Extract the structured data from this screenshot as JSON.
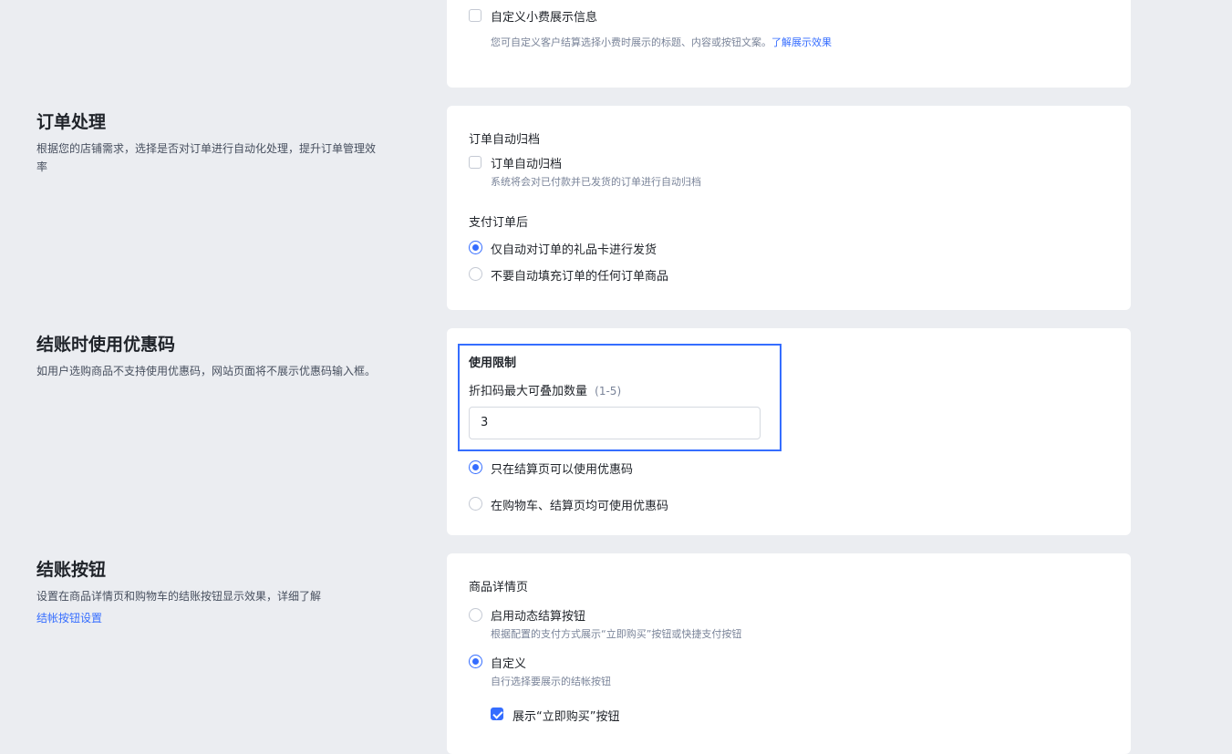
{
  "tip_section": {
    "checkbox_label": "自定义小费展示信息",
    "description": "您可自定义客户结算选择小费时展示的标题、内容或按钮文案。",
    "link": "了解展示效果"
  },
  "order_processing": {
    "title": "订单处理",
    "description": "根据您的店铺需求，选择是否对订单进行自动化处理，提升订单管理效率",
    "auto_archive_heading": "订单自动归档",
    "auto_archive_checkbox": "订单自动归档",
    "auto_archive_sub": "系统将会对已付款并已发货的订单进行自动归档",
    "after_payment_heading": "支付订单后",
    "options": [
      {
        "label": "仅自动对订单的礼品卡进行发货",
        "checked": true
      },
      {
        "label": "不要自动填充订单的任何订单商品",
        "checked": false
      }
    ]
  },
  "discount_code": {
    "title": "结账时使用优惠码",
    "description": "如用户选购商品不支持使用优惠码，网站页面将不展示优惠码输入框。",
    "usage_limit_heading": "使用限制",
    "max_stack_label": "折扣码最大可叠加数量",
    "max_stack_range": "(1-5)",
    "max_stack_value": "3",
    "options": [
      {
        "label": "只在结算页可以使用优惠码",
        "checked": true
      },
      {
        "label": "在购物车、结算页均可使用优惠码",
        "checked": false
      }
    ]
  },
  "checkout_button": {
    "title": "结账按钮",
    "description": "设置在商品详情页和购物车的结账按钮显示效果，详细了解",
    "link": "结帐按钮设置",
    "product_page_heading": "商品详情页",
    "options": [
      {
        "label": "启用动态结算按钮",
        "sub": "根据配置的支付方式展示“立即购买”按钮或快捷支付按钮",
        "checked": false
      },
      {
        "label": "自定义",
        "sub": "自行选择要展示的结帐按钮",
        "checked": true
      }
    ],
    "show_buy_now_label": "展示“立即购买”按钮",
    "show_buy_now_checked": true
  }
}
